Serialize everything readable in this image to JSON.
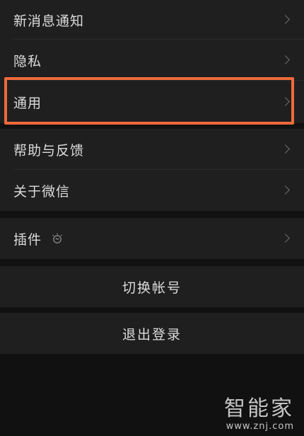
{
  "settings": {
    "items": [
      {
        "label": "新消息通知"
      },
      {
        "label": "隐私"
      },
      {
        "label": "通用"
      },
      {
        "label": "帮助与反馈"
      },
      {
        "label": "关于微信"
      }
    ],
    "plugins": {
      "label": "插件"
    },
    "switch_account": {
      "label": "切换帐号"
    },
    "logout": {
      "label": "退出登录"
    }
  },
  "highlight_color": "#ef6a3b",
  "watermark": {
    "text": "智能家",
    "url": "www.znj.com"
  }
}
